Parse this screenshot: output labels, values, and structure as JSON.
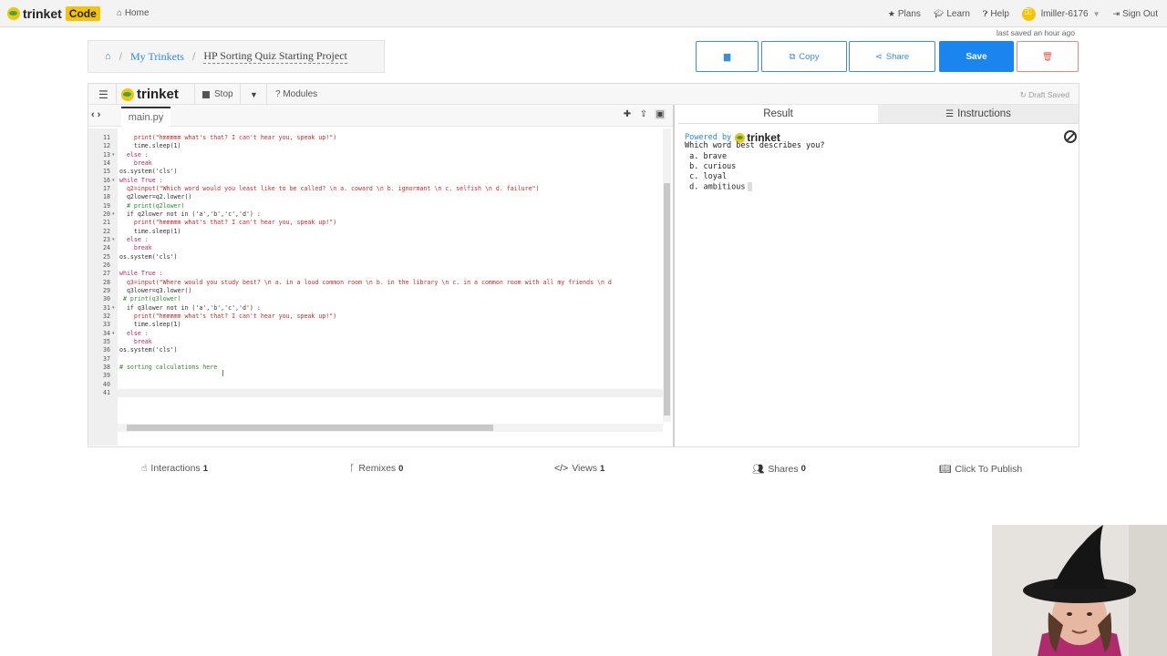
{
  "topnav": {
    "brand": "trinket",
    "brand_badge": "Code",
    "home": "Home",
    "plans": "Plans",
    "learn": "Learn",
    "help": "Help",
    "user": "lmiller-6176",
    "signout": "Sign Out",
    "last_saved": "last saved an hour ago"
  },
  "breadcrumb": {
    "my_trinkets": "My Trinkets",
    "project": "HP Sorting Quiz Starting Project",
    "sep": "/"
  },
  "actions": {
    "copy": "Copy",
    "share": "Share",
    "save": "Save"
  },
  "toolbar": {
    "logo": "trinket",
    "stop": "Stop",
    "modules": "Modules",
    "draft": "Draft Saved"
  },
  "editor": {
    "filename": "main.py",
    "lines": [
      {
        "n": "11",
        "fold": "",
        "text": "    print(\"hmmmmm what's that? I can't hear you, speak up!\")",
        "cls": "str"
      },
      {
        "n": "12",
        "fold": "",
        "text": "    time.sleep(1)",
        "cls": ""
      },
      {
        "n": "13",
        "fold": "▾",
        "text": "  else :",
        "cls": "kw"
      },
      {
        "n": "14",
        "fold": "",
        "text": "    break",
        "cls": "kw"
      },
      {
        "n": "15",
        "fold": "",
        "text": "os.system('cls')",
        "cls": ""
      },
      {
        "n": "16",
        "fold": "▾",
        "text": "while True :",
        "cls": "kw"
      },
      {
        "n": "17",
        "fold": "",
        "text": "  q2=input(\"Which word would you least like to be called? \\n a. coward \\n b. ignormant \\n c. selfish \\n d. failure\")",
        "cls": "str"
      },
      {
        "n": "18",
        "fold": "",
        "text": "  q2lower=q2.lower()",
        "cls": ""
      },
      {
        "n": "19",
        "fold": "",
        "text": "  # print(q2lower)",
        "cls": "com"
      },
      {
        "n": "20",
        "fold": "▾",
        "text": "  if q2lower not in ('a','b','c','d') :",
        "cls": ""
      },
      {
        "n": "21",
        "fold": "",
        "text": "    print(\"hmmmmm what's that? I can't hear you, speak up!\")",
        "cls": "str"
      },
      {
        "n": "22",
        "fold": "",
        "text": "    time.sleep(1)",
        "cls": ""
      },
      {
        "n": "23",
        "fold": "▾",
        "text": "  else :",
        "cls": "kw"
      },
      {
        "n": "24",
        "fold": "",
        "text": "    break",
        "cls": "kw"
      },
      {
        "n": "25",
        "fold": "",
        "text": "os.system('cls')",
        "cls": ""
      },
      {
        "n": "26",
        "fold": "",
        "text": "",
        "cls": ""
      },
      {
        "n": "27",
        "fold": "",
        "text": "while True :",
        "cls": "kw"
      },
      {
        "n": "28",
        "fold": "",
        "text": "  q3=input(\"Where would you study best? \\n a. in a loud common room \\n b. in the library \\n c. in a common room with all my friends \\n d",
        "cls": "str"
      },
      {
        "n": "29",
        "fold": "",
        "text": "  q3lower=q3.lower()",
        "cls": ""
      },
      {
        "n": "30",
        "fold": "",
        "text": " # print(q3lower)",
        "cls": "com"
      },
      {
        "n": "31",
        "fold": "▾",
        "text": "  if q3lower not in ('a','b','c','d') :",
        "cls": ""
      },
      {
        "n": "32",
        "fold": "",
        "text": "    print(\"hmmmmm what's that? I can't hear you, speak up!\")",
        "cls": "str"
      },
      {
        "n": "33",
        "fold": "",
        "text": "    time.sleep(1)",
        "cls": ""
      },
      {
        "n": "34",
        "fold": "▾",
        "text": "  else :",
        "cls": "kw"
      },
      {
        "n": "35",
        "fold": "",
        "text": "    break",
        "cls": "kw"
      },
      {
        "n": "36",
        "fold": "",
        "text": "os.system('cls')",
        "cls": ""
      },
      {
        "n": "37",
        "fold": "",
        "text": "",
        "cls": ""
      },
      {
        "n": "38",
        "fold": "",
        "text": "# sorting calculations here",
        "cls": "com"
      },
      {
        "n": "39",
        "fold": "",
        "text": "",
        "cls": ""
      },
      {
        "n": "40",
        "fold": "",
        "text": "",
        "cls": ""
      },
      {
        "n": "41",
        "fold": "",
        "text": "",
        "cls": ""
      }
    ]
  },
  "output": {
    "tab_result": "Result",
    "tab_instructions": "Instructions",
    "powered_by": "Powered by",
    "powered_logo": "trinket",
    "lines": [
      "Which word best describes you?",
      " a. brave",
      " b. curious",
      " c. loyal",
      " d. ambitious"
    ]
  },
  "stats": {
    "interactions": "Interactions",
    "interactions_count": "1",
    "remixes": "Remixes",
    "remixes_count": "0",
    "views": "Views",
    "views_count": "1",
    "shares": "Shares",
    "shares_count": "0",
    "publish": "Click To Publish"
  },
  "colors": {
    "accent": "#1a85ee",
    "brand_yellow": "#f5c400",
    "link": "#2b8ad9",
    "delete": "#e05a4c"
  }
}
